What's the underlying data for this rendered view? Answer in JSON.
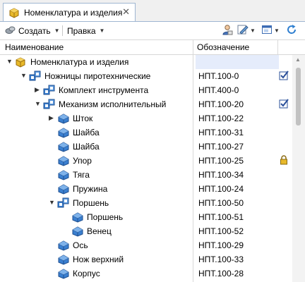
{
  "tab": {
    "title": "Номенклатура и изделия",
    "close": "✕",
    "icon": "product-icon"
  },
  "toolbar": {
    "create_label": "Создать",
    "edit_label": "Правка"
  },
  "columns": {
    "name": "Наименование",
    "code": "Обозначение"
  },
  "colors": {
    "accent": "#2060c0",
    "selection": "#e5ecfb",
    "part_blue": "#3a7fd0",
    "lock_gold": "#d6a21a"
  },
  "rows": [
    {
      "name": "Номенклатура и изделия",
      "code": "",
      "level": 0,
      "expand": "▼",
      "icon": "product-icon",
      "state": ""
    },
    {
      "name": "Ножницы пиротехнические",
      "code": "НПТ.100-0",
      "level": 1,
      "expand": "▼",
      "icon": "assembly-icon",
      "state": "check"
    },
    {
      "name": "Комплект инструмента",
      "code": "НПТ.400-0",
      "level": 2,
      "expand": "▶",
      "icon": "assembly-icon",
      "state": ""
    },
    {
      "name": "Механизм исполнительный",
      "code": "НПТ.100-20",
      "level": 2,
      "expand": "▼",
      "icon": "assembly-icon",
      "state": "check"
    },
    {
      "name": "Шток",
      "code": "НПТ.100-22",
      "level": 3,
      "expand": "▶",
      "icon": "part-icon",
      "state": ""
    },
    {
      "name": "Шайба",
      "code": "НПТ.100-31",
      "level": 3,
      "expand": "",
      "icon": "part-icon",
      "state": ""
    },
    {
      "name": "Шайба",
      "code": "НПТ.100-27",
      "level": 3,
      "expand": "",
      "icon": "part-icon",
      "state": ""
    },
    {
      "name": "Упор",
      "code": "НПТ.100-25",
      "level": 3,
      "expand": "",
      "icon": "part-icon",
      "state": "lock"
    },
    {
      "name": "Тяга",
      "code": "НПТ.100-34",
      "level": 3,
      "expand": "",
      "icon": "part-icon",
      "state": ""
    },
    {
      "name": "Пружина",
      "code": "НПТ.100-24",
      "level": 3,
      "expand": "",
      "icon": "part-icon",
      "state": ""
    },
    {
      "name": "Поршень",
      "code": "НПТ.100-50",
      "level": 3,
      "expand": "▼",
      "icon": "assembly-icon",
      "state": ""
    },
    {
      "name": "Поршень",
      "code": "НПТ.100-51",
      "level": 4,
      "expand": "",
      "icon": "part-icon",
      "state": ""
    },
    {
      "name": "Венец",
      "code": "НПТ.100-52",
      "level": 4,
      "expand": "",
      "icon": "part-icon",
      "state": ""
    },
    {
      "name": "Ось",
      "code": "НПТ.100-29",
      "level": 3,
      "expand": "",
      "icon": "part-icon",
      "state": ""
    },
    {
      "name": "Нож верхний",
      "code": "НПТ.100-33",
      "level": 3,
      "expand": "",
      "icon": "part-icon",
      "state": ""
    },
    {
      "name": "Корпус",
      "code": "НПТ.100-28",
      "level": 3,
      "expand": "",
      "icon": "part-icon",
      "state": ""
    }
  ]
}
